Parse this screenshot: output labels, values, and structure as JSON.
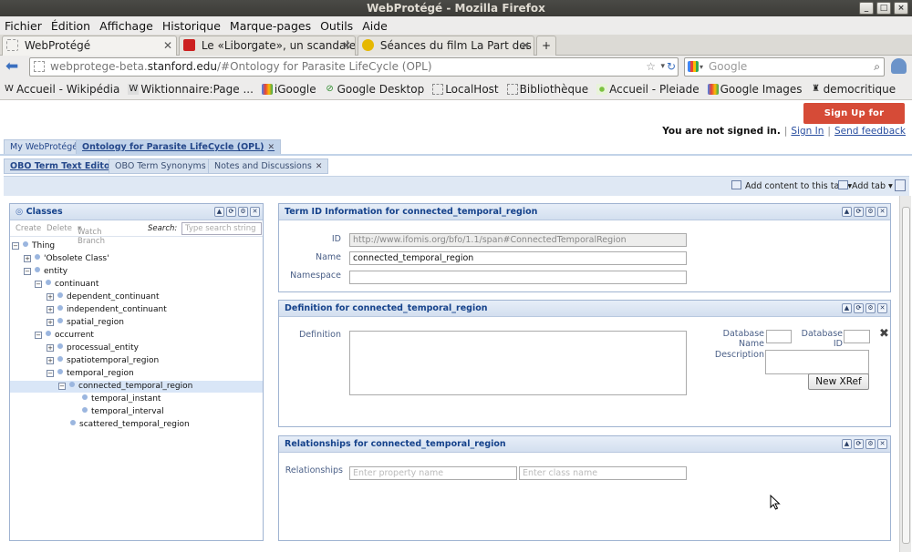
{
  "window": {
    "title": "WebProtégé - Mozilla Firefox"
  },
  "menubar": [
    "Fichier",
    "Édition",
    "Affichage",
    "Historique",
    "Marque-pages",
    "Outils",
    "Aide"
  ],
  "browser_tabs": [
    {
      "label": "WebProtégé",
      "active": true
    },
    {
      "label": "Le «Liborgate», un scandale ...",
      "active": false
    },
    {
      "label": "Séances du film La Part des ...",
      "active": false
    }
  ],
  "navbar": {
    "url_prefix": "webprotege-beta.",
    "url_domain": "stanford.edu",
    "url_path": "/#Ontology for Parasite LifeCycle (OPL)",
    "search_placeholder": "Google"
  },
  "bookmarks": [
    "Accueil - Wikipédia",
    "Wiktionnaire:Page ...",
    "iGoogle",
    "Google Desktop",
    "LocalHost",
    "Bibliothèque",
    "Accueil - Pleiade",
    "Google Images",
    "democritique"
  ],
  "account": {
    "signup_label": "Sign Up for Account",
    "status": "You are not signed in.",
    "signin_label": "Sign In",
    "feedback_label": "Send feedback"
  },
  "project_tabs": [
    {
      "label": "My WebProtégé",
      "active": false
    },
    {
      "label": "Ontology for Parasite LifeCycle (OPL)",
      "active": true
    }
  ],
  "sub_tabs": [
    {
      "label": "OBO Term Text Editor",
      "active": true
    },
    {
      "label": "OBO Term Synonyms",
      "active": false
    },
    {
      "label": "Notes and Discussions",
      "active": false
    }
  ],
  "tab_toolbar": {
    "add_content": "Add content to this tab",
    "add_tab": "Add tab"
  },
  "classes_panel": {
    "title": "Classes",
    "toolbar": {
      "create": "Create",
      "delete": "Delete",
      "watch": "Watch Branch",
      "search_label": "Search:",
      "search_placeholder": "Type search string"
    },
    "tree": [
      {
        "label": "Thing",
        "expander": "−"
      },
      {
        "label": "'Obsolete Class'",
        "expander": "+"
      },
      {
        "label": "entity",
        "expander": "−"
      },
      {
        "label": "continuant",
        "expander": "−"
      },
      {
        "label": "dependent_continuant",
        "expander": "+"
      },
      {
        "label": "independent_continuant",
        "expander": "+"
      },
      {
        "label": "spatial_region",
        "expander": "+"
      },
      {
        "label": "occurrent",
        "expander": "−"
      },
      {
        "label": "processual_entity",
        "expander": "+"
      },
      {
        "label": "spatiotemporal_region",
        "expander": "+"
      },
      {
        "label": "temporal_region",
        "expander": "−"
      },
      {
        "label": "connected_temporal_region",
        "expander": "−"
      },
      {
        "label": "temporal_instant",
        "expander": ""
      },
      {
        "label": "temporal_interval",
        "expander": ""
      },
      {
        "label": "scattered_temporal_region",
        "expander": ""
      }
    ]
  },
  "term_panel": {
    "title": "Term ID Information for connected_temporal_region",
    "id_label": "ID",
    "id_value": "http://www.ifomis.org/bfo/1.1/span#ConnectedTemporalRegion",
    "name_label": "Name",
    "name_value": "connected_temporal_region",
    "namespace_label": "Namespace",
    "namespace_value": ""
  },
  "definition_panel": {
    "title": "Definition for connected_temporal_region",
    "definition_label": "Definition",
    "db_name_label": "Database Name",
    "db_id_label": "Database ID",
    "description_label": "Description",
    "new_xref_label": "New XRef"
  },
  "relationships_panel": {
    "title": "Relationships for connected_temporal_region",
    "label": "Relationships",
    "property_placeholder": "Enter property name",
    "class_placeholder": "Enter class name"
  }
}
